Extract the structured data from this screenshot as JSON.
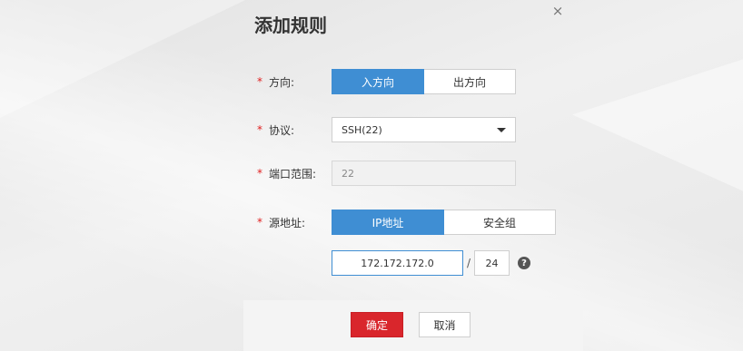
{
  "dialog": {
    "title": "添加规则",
    "close_glyph": "×"
  },
  "direction": {
    "label": "方向:",
    "options": [
      "入方向",
      "出方向"
    ],
    "selected": "入方向"
  },
  "protocol": {
    "label": "协议:",
    "value": "SSH(22)"
  },
  "port_range": {
    "label": "端口范围:",
    "value": "22"
  },
  "source": {
    "label": "源地址:",
    "options": [
      "IP地址",
      "安全组"
    ],
    "selected": "IP地址",
    "ip": "172.172.172.0",
    "slash": "/",
    "mask": "24",
    "help_glyph": "?"
  },
  "required_marker": "*",
  "footer": {
    "confirm_label": "确定",
    "cancel_label": "取消"
  },
  "colors": {
    "accent": "#3f8ed3",
    "primary_button": "#d9262c",
    "required": "#e02020"
  }
}
